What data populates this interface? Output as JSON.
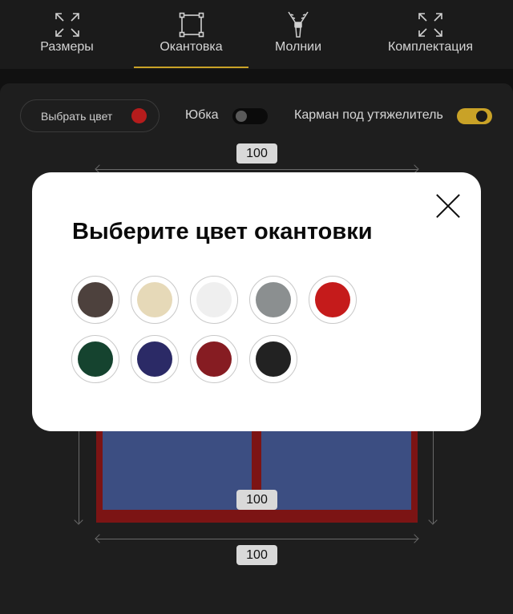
{
  "tabs": [
    {
      "label": "Размеры",
      "icon": "expand-arrows-icon",
      "active": false
    },
    {
      "label": "Окантовка",
      "icon": "frame-square-icon",
      "active": true
    },
    {
      "label": "Молнии",
      "icon": "zipper-icon",
      "active": false
    },
    {
      "label": "Комплектация",
      "icon": "expand-arrows-icon",
      "active": false
    }
  ],
  "options": {
    "choose_color_label": "Выбрать цвет",
    "selected_color": "#b51c1c",
    "skirt_label": "Юбка",
    "skirt_on": false,
    "pocket_label": "Карман под утяжелитель",
    "pocket_on": true,
    "accent_color": "#c9a227"
  },
  "drawing": {
    "top_width": "100",
    "middle_width": "100",
    "bottom_width": "100",
    "frame_color": "#7c1414",
    "pane_color": "#3c4e82"
  },
  "modal": {
    "title": "Выберите цвет окантовки",
    "close_icon": "close-icon",
    "colors": [
      "#4d413d",
      "#e6d9b8",
      "#efefef",
      "#8b8f90",
      "#c51b1b",
      "#15432f",
      "#2b2a66",
      "#861c22",
      "#222222"
    ]
  }
}
